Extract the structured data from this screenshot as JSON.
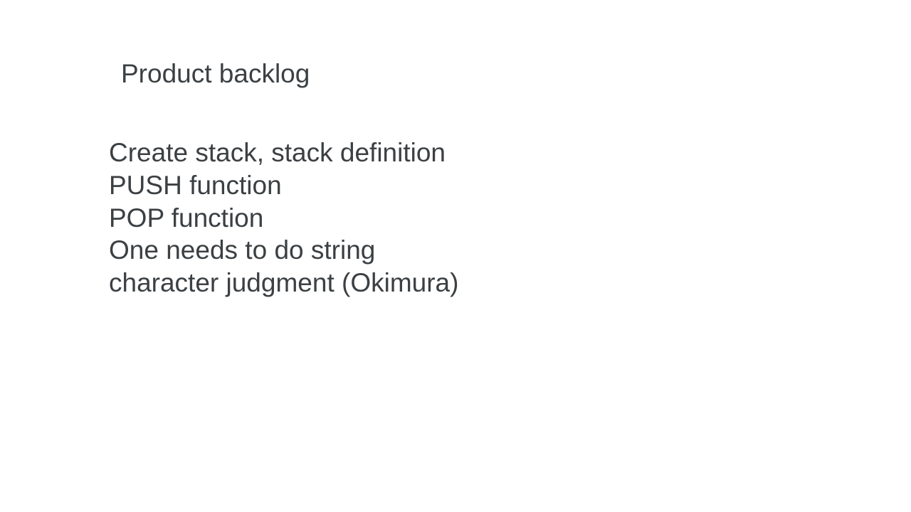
{
  "slide": {
    "title": "Product backlog",
    "lines": [
      "Create stack, stack definition",
      "PUSH function",
      "POP function",
      "One needs to do string",
      "character judgment (Okimura)"
    ]
  },
  "colors": {
    "background": "#ffffff",
    "text": "#3c4043"
  }
}
